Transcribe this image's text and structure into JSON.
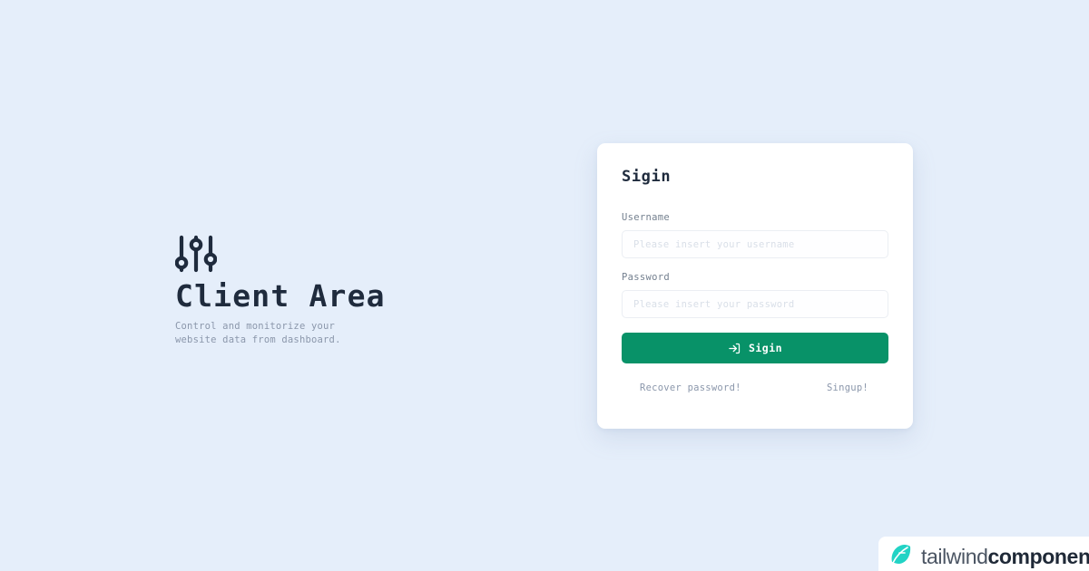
{
  "page": {
    "background_color": "#e5eefa"
  },
  "hero": {
    "icon": "sliders-icon",
    "title": "Client Area",
    "subtitle": "Control and monitorize your website data from dashboard.",
    "title_color": "#1f2b3d",
    "subtitle_color": "#8b97ab"
  },
  "card": {
    "title": "Sigin",
    "accent_color": "#089268",
    "fields": [
      {
        "name": "username",
        "label": "Username",
        "placeholder": "Please insert your username",
        "value": ""
      },
      {
        "name": "password",
        "label": "Password",
        "placeholder": "Please insert your password",
        "value": ""
      }
    ],
    "submit": {
      "label": "Sigin",
      "icon": "login-icon"
    },
    "links": {
      "recover": "Recover password!",
      "signup": "Singup!"
    }
  },
  "watermark": {
    "icon": "leaf-icon",
    "icon_color": "#22d3c5",
    "text_light": "tailwind",
    "text_bold": "components"
  }
}
